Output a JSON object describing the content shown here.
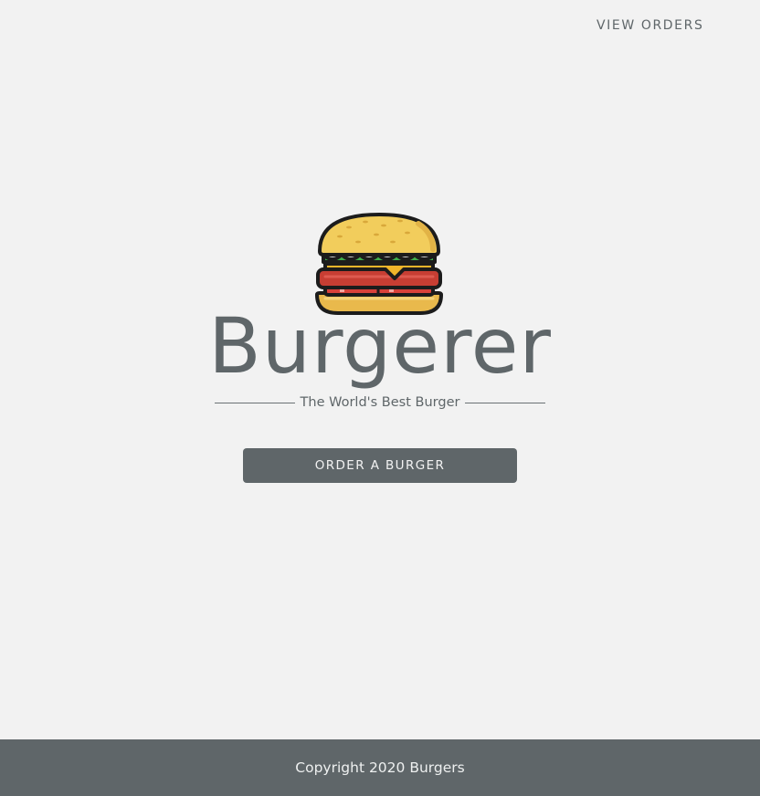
{
  "nav": {
    "view_orders_label": "VIEW ORDERS"
  },
  "hero": {
    "logo_icon": "burger-icon",
    "title": "Burgerer",
    "tagline": "The World's Best Burger",
    "order_button_label": "ORDER A BURGER"
  },
  "footer": {
    "copyright": "Copyright 2020 Burgers"
  },
  "colors": {
    "background": "#f2f2f2",
    "primary_gray": "#5f6669",
    "footer_text": "#eef0f0"
  }
}
